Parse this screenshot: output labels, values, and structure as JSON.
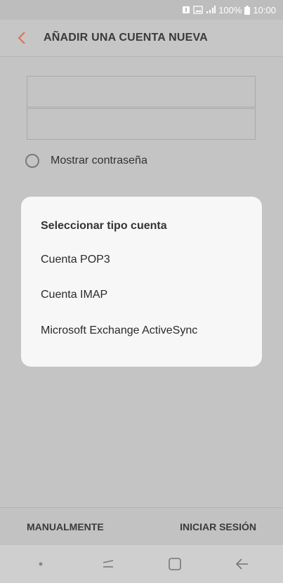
{
  "status_bar": {
    "battery": "100%",
    "time": "10:00"
  },
  "header": {
    "title": "AÑADIR UNA CUENTA NUEVA"
  },
  "form": {
    "show_password_label": "Mostrar contraseña"
  },
  "dialog": {
    "title": "Seleccionar tipo cuenta",
    "options": [
      "Cuenta POP3",
      "Cuenta IMAP",
      "Microsoft Exchange ActiveSync"
    ]
  },
  "actions": {
    "manual": "MANUALMENTE",
    "sign_in": "INICIAR SESIÓN"
  },
  "colors": {
    "back_arrow": "#e0704a",
    "dialog_bg": "#f7f7f7",
    "overlay": "#c4c4c4"
  }
}
